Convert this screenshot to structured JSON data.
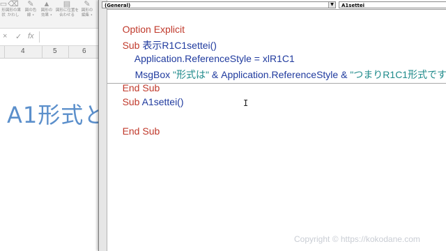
{
  "excel": {
    "ribbon": [
      {
        "icon": "shape-icon",
        "label": "形\n状"
      },
      {
        "icon": "eraser-icon",
        "label": "図形の果\nかわし"
      },
      {
        "icon": "shape-effect-icon",
        "label": "図の色\n線 •"
      },
      {
        "icon": "shape-fill-icon",
        "label": "図形の\n効果 •"
      },
      {
        "icon": "align-icon",
        "label": "図形に位置を\n合わせる"
      },
      {
        "icon": "edit-shape-icon",
        "label": "図形の\n編集 •"
      }
    ],
    "formula_bar": {
      "cancel": "×",
      "enter": "✓",
      "fx": "fx"
    },
    "columns": [
      "4",
      "5",
      "6"
    ],
    "big_text": "A1形式と"
  },
  "vbe": {
    "object_combo": "(General)",
    "procedure_combo": "A1settei",
    "code": {
      "line1_kw": "Option Explicit",
      "line2_kw": "Sub ",
      "line2_tx": "表示R1C1settei()",
      "line3_tx": "Application.ReferenceStyle = xlR1C1",
      "line4_a": "MsgBox ",
      "line4_b": "\"形式は\"",
      "line4_c": " & Application.ReferenceStyle & ",
      "line4_d": "\"つまりR1C1形式です",
      "line5_kw": "End Sub",
      "line6_kw": "Sub ",
      "line6_tx": "A1settei()",
      "line8_kw": "End Sub"
    },
    "colors": {
      "keyword": "#c0392b",
      "identifier": "#1f3a9e",
      "string": "#1e8a8a"
    }
  },
  "watermark": "Copyright © https://kokodane.com"
}
